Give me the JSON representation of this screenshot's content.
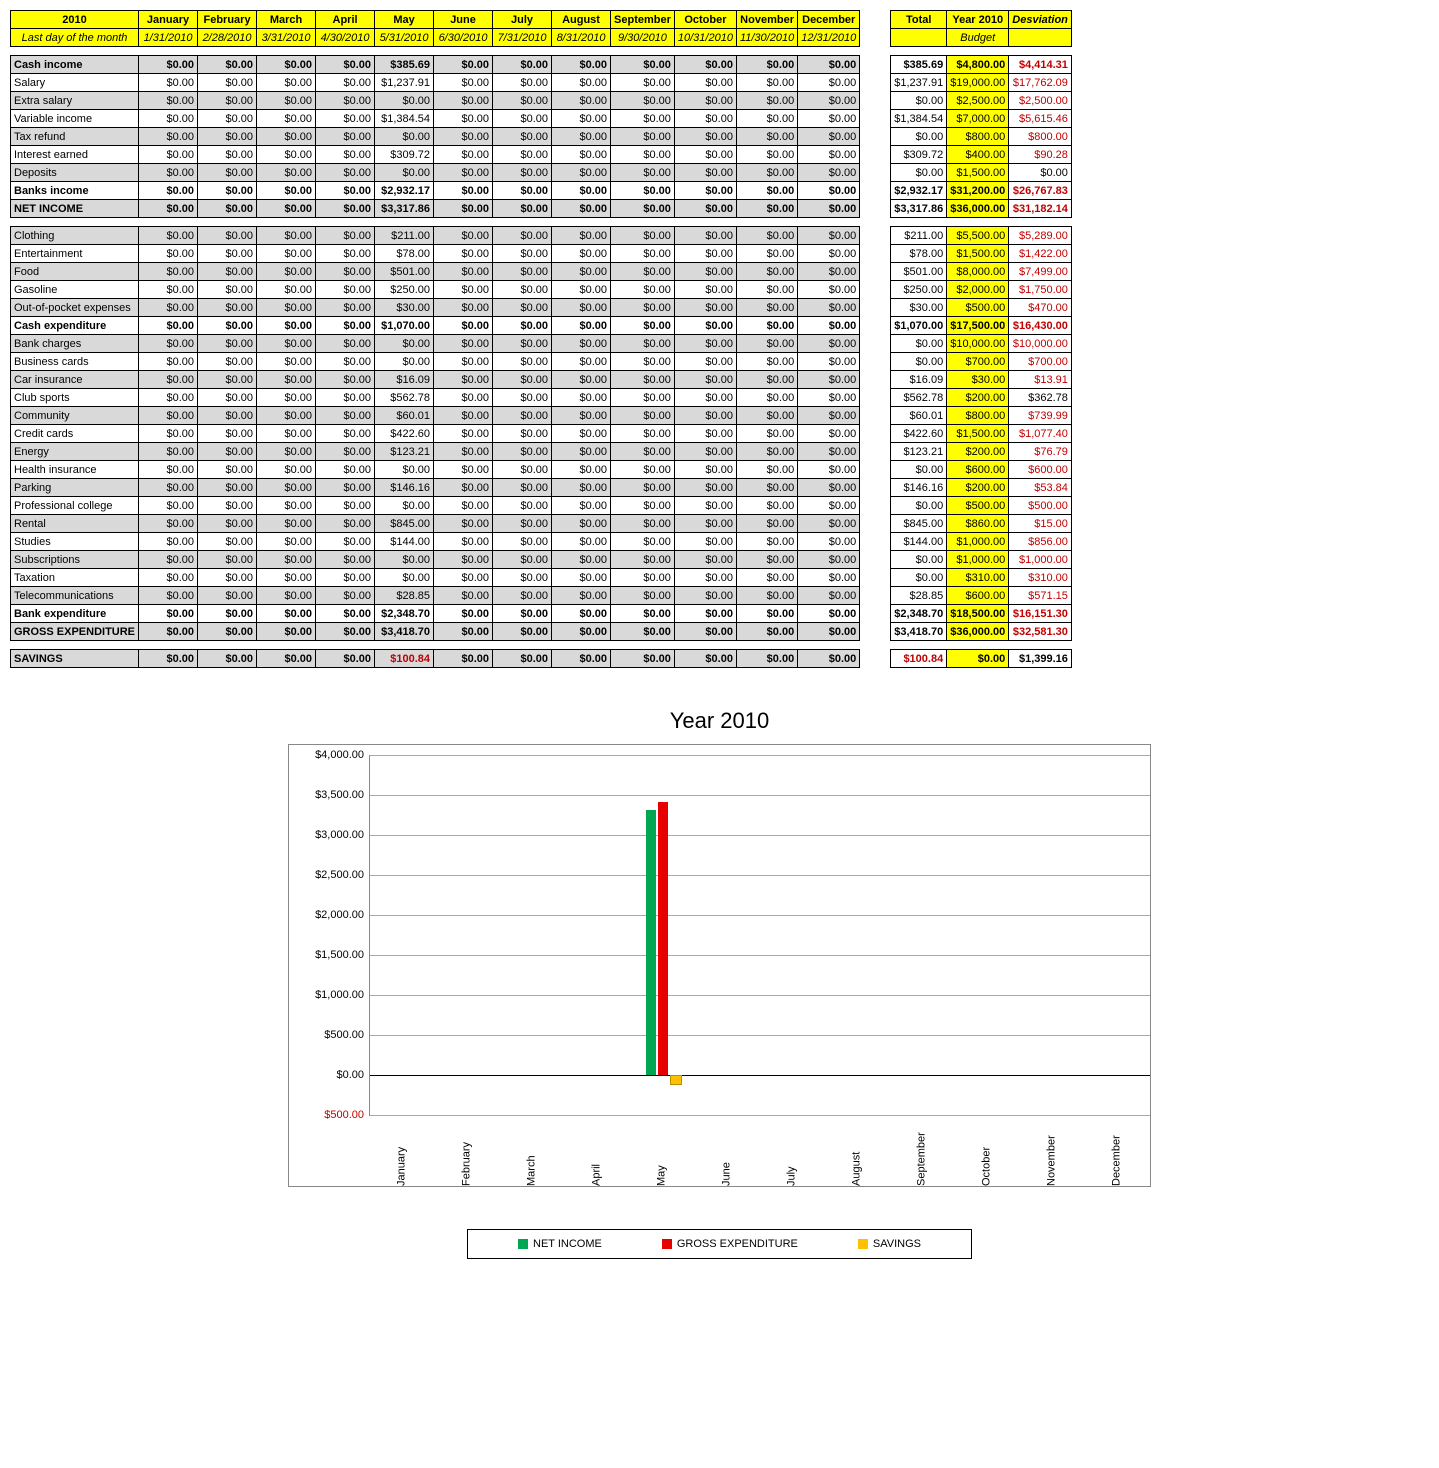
{
  "header": {
    "year": "2010",
    "sub": "Last day of the month",
    "months": [
      "January",
      "February",
      "March",
      "April",
      "May",
      "June",
      "July",
      "August",
      "September",
      "October",
      "November",
      "December"
    ],
    "dates": [
      "1/31/2010",
      "2/28/2010",
      "3/31/2010",
      "4/30/2010",
      "5/31/2010",
      "6/30/2010",
      "7/31/2010",
      "8/31/2010",
      "9/30/2010",
      "10/31/2010",
      "11/30/2010",
      "12/31/2010"
    ],
    "sum_hdr": [
      "Total",
      "Year 2010",
      "Desviation"
    ],
    "sum_sub": "Budget"
  },
  "rows": [
    {
      "label": "Cash income",
      "bold": true,
      "alt": true,
      "may": "$385.69",
      "tot": "$385.69",
      "bud": "$4,800.00",
      "dev": "$4,414.31",
      "devred": true
    },
    {
      "label": "Salary",
      "may": "$1,237.91",
      "tot": "$1,237.91",
      "bud": "$19,000.00",
      "dev": "$17,762.09",
      "devred": true
    },
    {
      "label": "Extra salary",
      "alt": true,
      "may": "$0.00",
      "tot": "$0.00",
      "bud": "$2,500.00",
      "dev": "$2,500.00",
      "devred": true
    },
    {
      "label": "Variable income",
      "may": "$1,384.54",
      "tot": "$1,384.54",
      "bud": "$7,000.00",
      "dev": "$5,615.46",
      "devred": true
    },
    {
      "label": "Tax refund",
      "alt": true,
      "may": "$0.00",
      "tot": "$0.00",
      "bud": "$800.00",
      "dev": "$800.00",
      "devred": true
    },
    {
      "label": "Interest earned",
      "may": "$309.72",
      "tot": "$309.72",
      "bud": "$400.00",
      "dev": "$90.28",
      "devred": true
    },
    {
      "label": "Deposits",
      "alt": true,
      "may": "$0.00",
      "tot": "$0.00",
      "bud": "$1,500.00",
      "dev": "$0.00",
      "devred": false
    },
    {
      "label": "Banks income",
      "bold": true,
      "may": "$2,932.17",
      "tot": "$2,932.17",
      "bud": "$31,200.00",
      "dev": "$26,767.83",
      "devred": true
    },
    {
      "label": "NET INCOME",
      "bold": true,
      "alt": true,
      "may": "$3,317.86",
      "tot": "$3,317.86",
      "bud": "$36,000.00",
      "dev": "$31,182.14",
      "devred": true
    },
    {
      "spacer": true
    },
    {
      "label": "Clothing",
      "alt": true,
      "may": "$211.00",
      "tot": "$211.00",
      "bud": "$5,500.00",
      "dev": "$5,289.00",
      "devred": true
    },
    {
      "label": "Entertainment",
      "may": "$78.00",
      "tot": "$78.00",
      "bud": "$1,500.00",
      "dev": "$1,422.00",
      "devred": true
    },
    {
      "label": "Food",
      "alt": true,
      "may": "$501.00",
      "tot": "$501.00",
      "bud": "$8,000.00",
      "dev": "$7,499.00",
      "devred": true
    },
    {
      "label": "Gasoline",
      "may": "$250.00",
      "tot": "$250.00",
      "bud": "$2,000.00",
      "dev": "$1,750.00",
      "devred": true
    },
    {
      "label": "Out-of-pocket expenses",
      "alt": true,
      "may": "$30.00",
      "tot": "$30.00",
      "bud": "$500.00",
      "dev": "$470.00",
      "devred": true
    },
    {
      "label": "Cash expenditure",
      "bold": true,
      "may": "$1,070.00",
      "tot": "$1,070.00",
      "bud": "$17,500.00",
      "dev": "$16,430.00",
      "devred": true
    },
    {
      "label": "Bank charges",
      "alt": true,
      "may": "$0.00",
      "tot": "$0.00",
      "bud": "$10,000.00",
      "dev": "$10,000.00",
      "devred": true
    },
    {
      "label": "Business cards",
      "may": "$0.00",
      "tot": "$0.00",
      "bud": "$700.00",
      "dev": "$700.00",
      "devred": true
    },
    {
      "label": "Car insurance",
      "alt": true,
      "may": "$16.09",
      "tot": "$16.09",
      "bud": "$30.00",
      "dev": "$13.91",
      "devred": true
    },
    {
      "label": "Club sports",
      "may": "$562.78",
      "tot": "$562.78",
      "bud": "$200.00",
      "dev": "$362.78",
      "devred": false
    },
    {
      "label": "Community",
      "alt": true,
      "may": "$60.01",
      "tot": "$60.01",
      "bud": "$800.00",
      "dev": "$739.99",
      "devred": true
    },
    {
      "label": "Credit cards",
      "may": "$422.60",
      "tot": "$422.60",
      "bud": "$1,500.00",
      "dev": "$1,077.40",
      "devred": true
    },
    {
      "label": "Energy",
      "alt": true,
      "may": "$123.21",
      "tot": "$123.21",
      "bud": "$200.00",
      "dev": "$76.79",
      "devred": true
    },
    {
      "label": "Health insurance",
      "may": "$0.00",
      "tot": "$0.00",
      "bud": "$600.00",
      "dev": "$600.00",
      "devred": true
    },
    {
      "label": "Parking",
      "alt": true,
      "may": "$146.16",
      "tot": "$146.16",
      "bud": "$200.00",
      "dev": "$53.84",
      "devred": true
    },
    {
      "label": "Professional college",
      "may": "$0.00",
      "tot": "$0.00",
      "bud": "$500.00",
      "dev": "$500.00",
      "devred": true
    },
    {
      "label": "Rental",
      "alt": true,
      "may": "$845.00",
      "tot": "$845.00",
      "bud": "$860.00",
      "dev": "$15.00",
      "devred": true
    },
    {
      "label": "Studies",
      "may": "$144.00",
      "tot": "$144.00",
      "bud": "$1,000.00",
      "dev": "$856.00",
      "devred": true
    },
    {
      "label": "Subscriptions",
      "alt": true,
      "may": "$0.00",
      "tot": "$0.00",
      "bud": "$1,000.00",
      "dev": "$1,000.00",
      "devred": true
    },
    {
      "label": "Taxation",
      "may": "$0.00",
      "tot": "$0.00",
      "bud": "$310.00",
      "dev": "$310.00",
      "devred": true
    },
    {
      "label": "Telecommunications",
      "alt": true,
      "may": "$28.85",
      "tot": "$28.85",
      "bud": "$600.00",
      "dev": "$571.15",
      "devred": true
    },
    {
      "label": "Bank expenditure",
      "bold": true,
      "may": "$2,348.70",
      "tot": "$2,348.70",
      "bud": "$18,500.00",
      "dev": "$16,151.30",
      "devred": true
    },
    {
      "label": "GROSS EXPENDITURE",
      "bold": true,
      "alt": true,
      "may": "$3,418.70",
      "tot": "$3,418.70",
      "bud": "$36,000.00",
      "dev": "$32,581.30",
      "devred": true
    },
    {
      "spacer": true
    },
    {
      "label": "SAVINGS",
      "bold": true,
      "alt": true,
      "may": "$100.84",
      "mayred": true,
      "tot": "$100.84",
      "totred": true,
      "bud": "$0.00",
      "dev": "$1,399.16",
      "devred": false
    }
  ],
  "chart_data": {
    "type": "bar",
    "title": "Year 2010",
    "categories": [
      "January",
      "February",
      "March",
      "April",
      "May",
      "June",
      "July",
      "August",
      "September",
      "October",
      "November",
      "December"
    ],
    "series": [
      {
        "name": "NET INCOME",
        "color": "#00a651",
        "values": [
          0,
          0,
          0,
          0,
          3317.86,
          0,
          0,
          0,
          0,
          0,
          0,
          0
        ]
      },
      {
        "name": "GROSS EXPENDITURE",
        "color": "#e60000",
        "values": [
          0,
          0,
          0,
          0,
          3418.7,
          0,
          0,
          0,
          0,
          0,
          0,
          0
        ]
      },
      {
        "name": "SAVINGS",
        "color": "#ffc000",
        "values": [
          0,
          0,
          0,
          0,
          -100.84,
          0,
          0,
          0,
          0,
          0,
          0,
          0
        ]
      }
    ],
    "ylim": [
      -500,
      4000
    ],
    "yticks": [
      "$500.00",
      "$0.00",
      "$500.00",
      "$1,000.00",
      "$1,500.00",
      "$2,000.00",
      "$2,500.00",
      "$3,000.00",
      "$3,500.00",
      "$4,000.00"
    ],
    "ytick_values": [
      -500,
      0,
      500,
      1000,
      1500,
      2000,
      2500,
      3000,
      3500,
      4000
    ]
  }
}
